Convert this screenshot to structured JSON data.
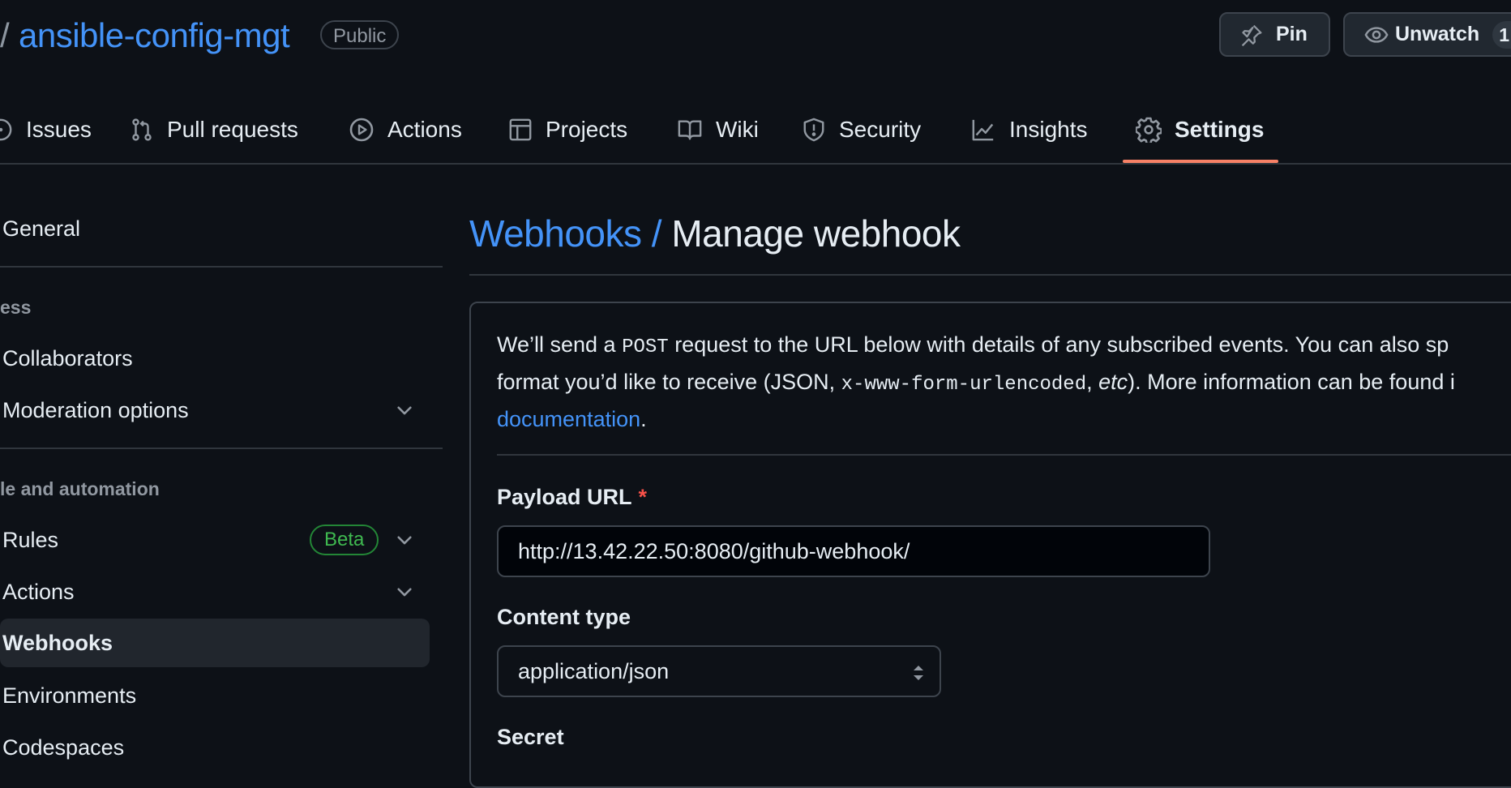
{
  "header": {
    "slash": "/",
    "repo_name": "ansible-config-mgt",
    "visibility_badge": "Public",
    "pin_label": "Pin",
    "unwatch_label": "Unwatch",
    "watch_count": "1"
  },
  "tabs": [
    {
      "label": "Issues",
      "icon": "issue-icon"
    },
    {
      "label": "Pull requests",
      "icon": "pull-request-icon"
    },
    {
      "label": "Actions",
      "icon": "play-icon"
    },
    {
      "label": "Projects",
      "icon": "table-icon"
    },
    {
      "label": "Wiki",
      "icon": "book-icon"
    },
    {
      "label": "Security",
      "icon": "shield-icon"
    },
    {
      "label": "Insights",
      "icon": "graph-icon"
    },
    {
      "label": "Settings",
      "icon": "gear-icon",
      "selected": true
    }
  ],
  "sidebar": {
    "general": "General",
    "access_section": "ess",
    "collaborators": "Collaborators",
    "moderation": "Moderation options",
    "code_section": "le and automation",
    "rules": "Rules",
    "rules_badge": "Beta",
    "actions": "Actions",
    "webhooks": "Webhooks",
    "environments": "Environments",
    "codespaces": "Codespaces"
  },
  "main": {
    "breadcrumb": "Webhooks /",
    "title": "Manage webhook",
    "desc_line1_a": "We’ll send a ",
    "desc_line1_code": "POST",
    "desc_line1_b": " request to the URL below with details of any subscribed events. You can also sp",
    "desc_line2_a": "format you’d like to receive (JSON, ",
    "desc_line2_code": "x-www-form-urlencoded",
    "desc_line2_b": ", ",
    "desc_line2_em": "etc",
    "desc_line2_c": "). More information can be found i",
    "desc_link": "documentation",
    "desc_end": ".",
    "payload_label": "Payload URL",
    "required_mark": "*",
    "payload_value": "http://13.42.22.50:8080/github-webhook/",
    "content_type_label": "Content type",
    "content_type_value": "application/json",
    "secret_label": "Secret"
  },
  "colors": {
    "background": "#0d1117",
    "accent_link": "#4493f8",
    "tab_underline": "#f78166",
    "beta_green": "#3fb950",
    "required_red": "#f85149"
  }
}
